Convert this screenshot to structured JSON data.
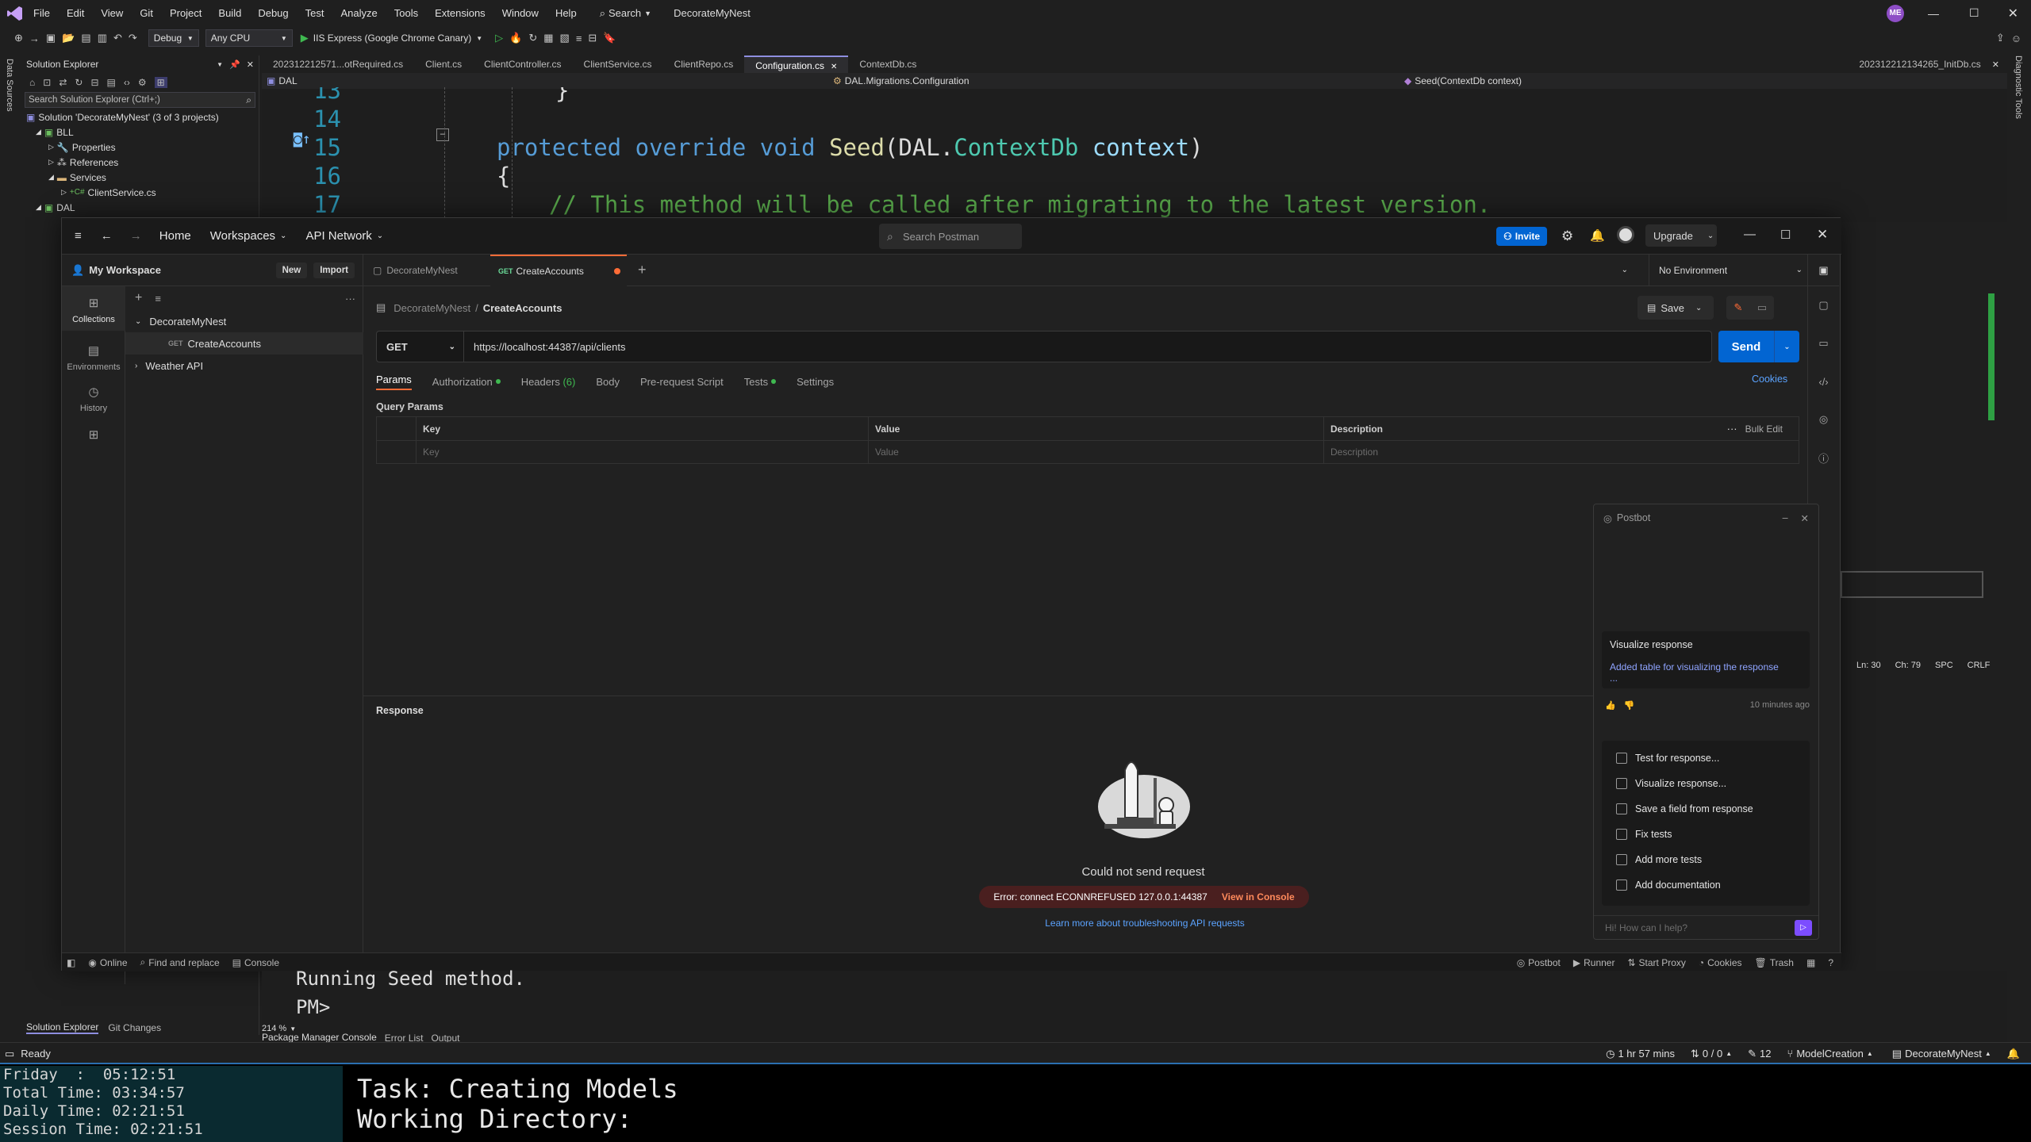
{
  "vs": {
    "menu": [
      "File",
      "Edit",
      "View",
      "Git",
      "Project",
      "Build",
      "Debug",
      "Test",
      "Analyze",
      "Tools",
      "Extensions",
      "Window",
      "Help"
    ],
    "search_label": "Search",
    "solution_name": "DecorateMyNest",
    "avatar_initials": "ME",
    "config": "Debug",
    "platform": "Any CPU",
    "run_target": "IIS Express (Google Chrome Canary)",
    "left_rail_label": "Data Sources",
    "right_rail_label": "Diagnostic Tools",
    "solution_explorer": {
      "title": "Solution Explorer",
      "search_placeholder": "Search Solution Explorer (Ctrl+;)",
      "solution_line": "Solution 'DecorateMyNest' (3 of 3 projects)",
      "bll": "BLL",
      "properties": "Properties",
      "references": "References",
      "services": "Services",
      "client_service": "ClientService.cs",
      "dal": "DAL",
      "bottom_tabs": [
        "Solution Explorer",
        "Git Changes"
      ]
    },
    "editor": {
      "tabs": [
        "202312212571...otRequired.cs",
        "Client.cs",
        "ClientController.cs",
        "ClientService.cs",
        "ClientRepo.cs",
        "Configuration.cs",
        "ContextDb.cs"
      ],
      "active_tab": "Configuration.cs",
      "right_tab": "202312212134265_InitDb.cs",
      "nav_project": "DAL",
      "nav_class": "DAL.Migrations.Configuration",
      "nav_member": "Seed(ContextDb context)",
      "line_numbers": [
        "13",
        "14",
        "15",
        "16",
        "17"
      ],
      "line13": "}",
      "line15_kw1": "protected",
      "line15_kw2": "override",
      "line15_kw3": "void",
      "line15_method": "Seed",
      "line15_ns": "DAL.",
      "line15_type": "ContextDb",
      "line15_param": "context",
      "line16": "{",
      "line17": "//  This method will be called after migrating to the latest version."
    },
    "editor_status": {
      "ln": "Ln: 30",
      "ch": "Ch: 79",
      "spc": "SPC",
      "crlf": "CRLF"
    },
    "console": {
      "line1": "Running Seed method.",
      "line2": "PM>",
      "zoom": "214 %",
      "tabs": [
        "Package Manager Console",
        "Error List",
        "Output"
      ]
    },
    "statusbar": {
      "ready": "Ready",
      "time": "1 hr 57 mins",
      "arrows": "0 / 0",
      "pencil": "12",
      "branch": "ModelCreation",
      "repo": "DecorateMyNest"
    }
  },
  "postman": {
    "nav": {
      "home": "Home",
      "workspaces": "Workspaces",
      "api_network": "API Network"
    },
    "search_placeholder": "Search Postman",
    "invite": "Invite",
    "upgrade": "Upgrade",
    "workspace_name": "My Workspace",
    "new_btn": "New",
    "import_btn": "Import",
    "rail": [
      "Collections",
      "Environments",
      "History"
    ],
    "tree": {
      "collection": "DecorateMyNest",
      "method": "GET",
      "request": "CreateAccounts",
      "other": "Weather API"
    },
    "tabs": {
      "tab1": "DecorateMyNest",
      "tab2_method": "GET",
      "tab2": "CreateAccounts"
    },
    "environment": "No Environment",
    "breadcrumb": {
      "parent": "DecorateMyNest",
      "sep": "/",
      "current": "CreateAccounts"
    },
    "save": "Save",
    "method": "GET",
    "url": "https://localhost:44387/api/clients",
    "send": "Send",
    "request_tabs": [
      "Params",
      "Authorization",
      "Headers",
      "(6)",
      "Body",
      "Pre-request Script",
      "Tests",
      "Settings"
    ],
    "cookies": "Cookies",
    "query_params": "Query Params",
    "table": {
      "key": "Key",
      "value": "Value",
      "description": "Description",
      "bulk_edit": "Bulk Edit",
      "ph_key": "Key",
      "ph_value": "Value",
      "ph_desc": "Description"
    },
    "response": "Response",
    "could_not_send": "Could not send request",
    "error": "Error: connect ECONNREFUSED 127.0.0.1:44387",
    "view_console": "View in Console",
    "learn_more": "Learn more about troubleshooting API requests",
    "postbot": {
      "title": "Postbot",
      "card_title": "Visualize response",
      "card_text": "Added table for visualizing the response",
      "card_more": "...",
      "time": "10 minutes ago",
      "suggestions": [
        "Test for response...",
        "Visualize response...",
        "Save a field from response",
        "Fix tests",
        "Add more tests",
        "Add documentation"
      ],
      "input_placeholder": "Hi! How can I help?"
    },
    "status": {
      "online": "Online",
      "find": "Find and replace",
      "console": "Console",
      "postbot": "Postbot",
      "runner": "Runner",
      "proxy": "Start Proxy",
      "cookies": "Cookies",
      "trash": "Trash"
    }
  },
  "terminal": {
    "friday": "Friday  :  05:12:51",
    "total": "Total Time: 03:34:57",
    "daily": "Daily Time: 02:21:51",
    "session": "Session Time: 02:21:51",
    "task": "Task: Creating Models",
    "dir": "Working Directory:"
  },
  "colors": {
    "accent_orange": "#ff6c37",
    "send_blue": "#0265d2",
    "vs_purple": "#8e4ec6",
    "keyword_blue": "#569cd6",
    "comment_green": "#57a64a"
  }
}
